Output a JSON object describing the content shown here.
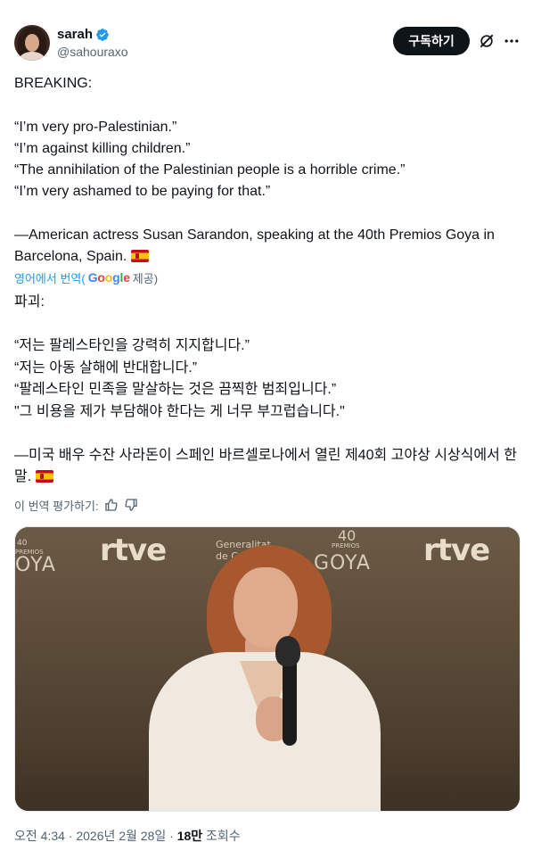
{
  "user": {
    "display_name": "sarah",
    "handle": "@sahouraxo",
    "verified": true,
    "verified_color": "#1d9bf0"
  },
  "actions": {
    "subscribe_label": "구독하기",
    "grok_icon": "grok-icon",
    "more_icon": "more-icon"
  },
  "tweet": {
    "text": "BREAKING:\n\n“I’m very pro-Palestinian.”\n“I’m against killing children.”\n“The annihilation of the Palestinian people is a horrible crime.”\n“I’m very ashamed to be paying for that.”\n\n—American actress Susan Sarandon, speaking at the 40th Premios Goya in Barcelona, Spain. ",
    "flag_icon": "spain-flag-icon"
  },
  "translation": {
    "source_label": "영어에서 번역(",
    "provider_letters": [
      "G",
      "o",
      "o",
      "g",
      "l",
      "e"
    ],
    "provided_label": " 제공)",
    "text": "파괴:\n\n“저는 팔레스타인을 강력히 지지합니다.”\n“저는 아동 살해에 반대합니다.”\n“팔레스타인 민족을 말살하는 것은 끔찍한 범죄입니다.”\n\"그 비용을 제가 부담해야 한다는 게 너무 부끄럽습니다.\"\n\n—미국 배우 수잔 사라돈이 스페인 바르셀로나에서 열린 제40회 고야상 시상식에서 한 말. ",
    "rate_label": "이 번역 평가하기:"
  },
  "media": {
    "backdrop_logos": {
      "rtve_1": "rtve",
      "rtve_2": "rtve",
      "goya_small_num": "40",
      "goya_small_premios": "PREMIOS",
      "goya_left": "OYA",
      "goya_center": "GOYA",
      "goya_center_num": "40",
      "goya_center_premios": "PREMIOS",
      "generalitat": "Generalitat",
      "generalitat_2": "de Catalunya"
    }
  },
  "footer": {
    "time": "오전 4:34 · 2026년 2월 28일 · ",
    "views_count": "18만",
    "views_label": " 조회수"
  }
}
